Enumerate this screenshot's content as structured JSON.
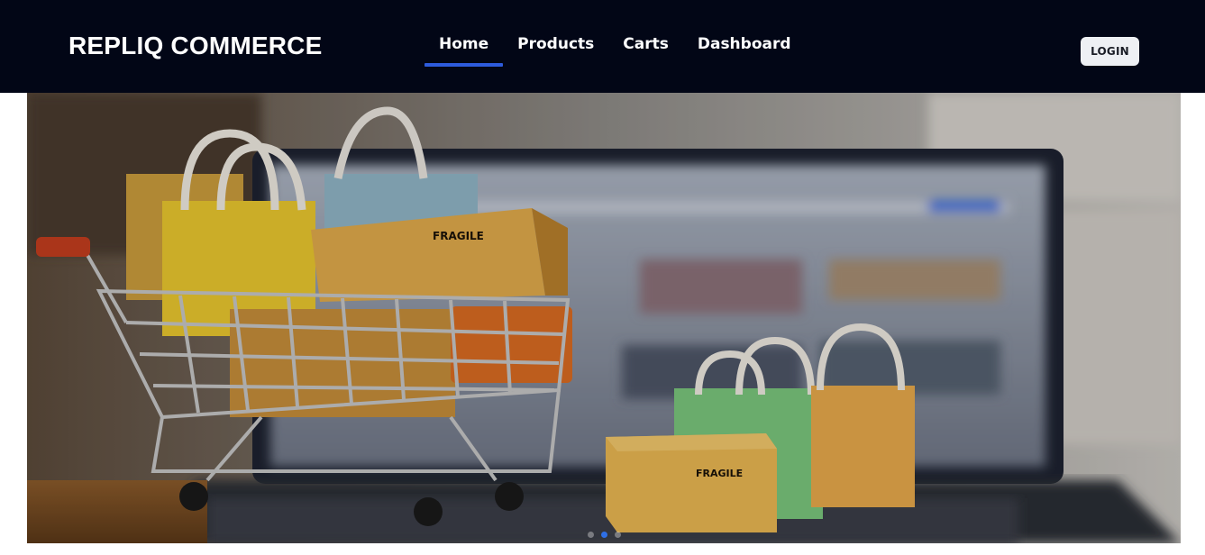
{
  "brand": {
    "name": "REPLIQ COMMERCE"
  },
  "nav": {
    "items": [
      {
        "label": "Home",
        "active": true
      },
      {
        "label": "Products",
        "active": false
      },
      {
        "label": "Carts",
        "active": false
      },
      {
        "label": "Dashboard",
        "active": false
      }
    ]
  },
  "auth": {
    "login_label": "LOGIN"
  },
  "hero": {
    "image_icon": "shopping-cart-laptop-image",
    "box_label_1": "FRAGILE",
    "box_label_2": "FRAGILE",
    "slides_total": 3,
    "active_slide": 2
  },
  "colors": {
    "navbar_bg": "#020616",
    "accent": "#2d5bdc",
    "login_bg": "#eef0f4"
  }
}
